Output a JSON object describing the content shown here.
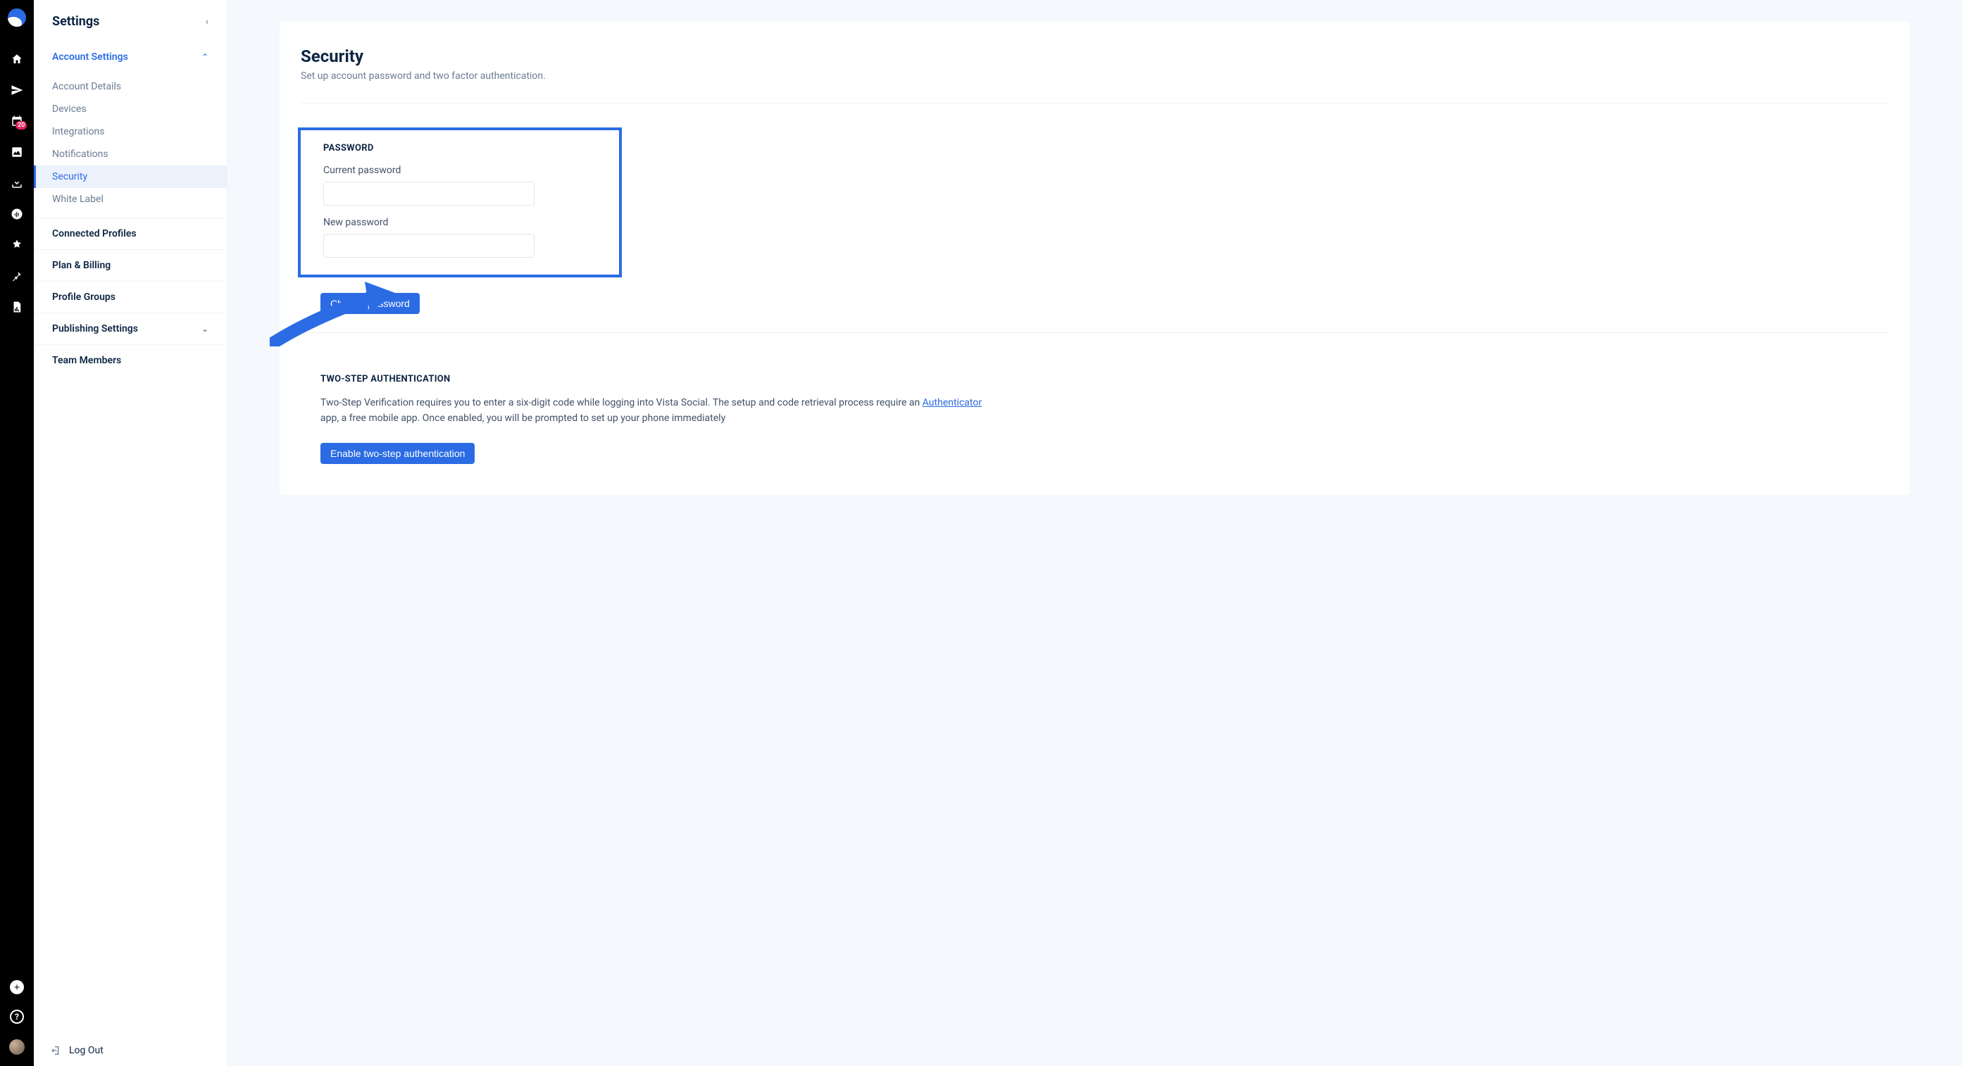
{
  "nav_rail": {
    "calendar_badge": "20"
  },
  "sidebar": {
    "title": "Settings",
    "sections": [
      {
        "label": "Account Settings",
        "expanded": true
      },
      {
        "label": "Connected Profiles"
      },
      {
        "label": "Plan & Billing"
      },
      {
        "label": "Profile Groups"
      },
      {
        "label": "Publishing Settings",
        "expandable": true
      },
      {
        "label": "Team Members"
      }
    ],
    "account_sub": [
      "Account Details",
      "Devices",
      "Integrations",
      "Notifications",
      "Security",
      "White Label"
    ],
    "logout_label": "Log Out"
  },
  "main": {
    "title": "Security",
    "subtitle": "Set up account password and two factor authentication.",
    "password_section": {
      "heading": "PASSWORD",
      "current_label": "Current password",
      "new_label": "New password",
      "button": "Change password"
    },
    "twostep_section": {
      "heading": "TWO-STEP AUTHENTICATION",
      "body_1": "Two-Step Verification requires you to enter a six-digit code while logging into Vista Social. The setup and code retrieval process require an ",
      "link_text": "Authenticator",
      "body_2": " app, a free mobile app. Once enabled, you will be prompted to set up your phone immediately",
      "button": "Enable two-step authentication"
    }
  }
}
